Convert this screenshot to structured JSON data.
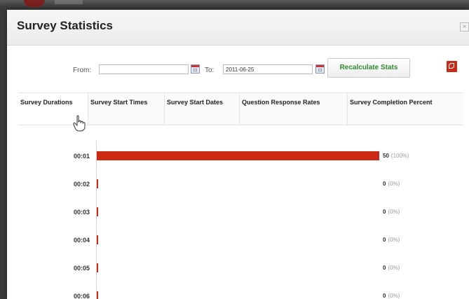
{
  "dialog": {
    "title": "Survey Statistics",
    "close_glyph": "×"
  },
  "filter": {
    "from_label": "From:",
    "from_value": "",
    "to_label": "To:",
    "to_value": "2011-06-25",
    "recalc_label": "Recalculate Stats"
  },
  "tabs": [
    "Survey Durations",
    "Survey Start Times",
    "Survey Start Dates",
    "Question Response Rates",
    "Survey Completion Percent"
  ],
  "active_tab": "Survey Durations",
  "chart_data": {
    "type": "bar",
    "orientation": "horizontal",
    "categories": [
      "00:01",
      "00:02",
      "00:03",
      "00:04",
      "00:05",
      "00:06"
    ],
    "values": [
      50,
      0,
      0,
      0,
      0,
      0
    ],
    "percent_labels": [
      "(100%)",
      "(0%)",
      "(0%)",
      "(0%)",
      "(0%)",
      "(0%)"
    ],
    "max_percent": 100,
    "bar_color": "#cc2a14"
  },
  "icons": {
    "calendar": "calendar-icon",
    "pdf": "pdf-icon",
    "cursor": "hand-cursor-icon"
  }
}
